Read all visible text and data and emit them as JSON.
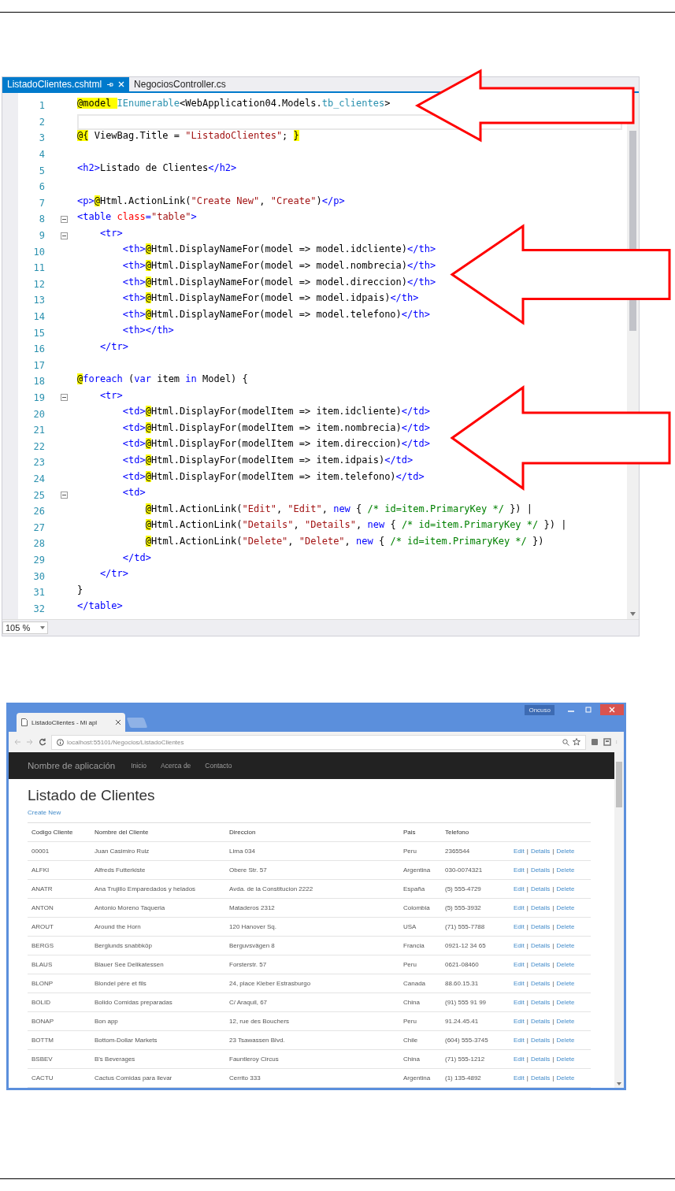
{
  "editor": {
    "tabs": [
      {
        "label": "ListadoClientes.cshtml",
        "selected": true
      },
      {
        "label": "NegociosController.cs",
        "selected": false
      }
    ],
    "lines": [
      {
        "number": "1",
        "segments": [
          {
            "kind": "razor",
            "text": "@model "
          },
          {
            "kind": "type",
            "text": "IEnumerable"
          },
          {
            "kind": "plain",
            "text": "<WebApplication04.Models."
          },
          {
            "kind": "type",
            "text": "tb_clientes"
          },
          {
            "kind": "plain",
            "text": ">"
          }
        ]
      },
      {
        "number": "2",
        "current": true
      },
      {
        "number": "3",
        "segments": [
          {
            "kind": "razor",
            "text": "@{"
          },
          {
            "kind": "plain",
            "text": " ViewBag.Title = "
          },
          {
            "kind": "string",
            "text": "\"ListadoClientes\""
          },
          {
            "kind": "plain",
            "text": "; "
          },
          {
            "kind": "razor",
            "text": "}"
          }
        ]
      },
      {
        "number": "4"
      },
      {
        "number": "5",
        "segments": [
          {
            "kind": "tag",
            "text": "<h2>"
          },
          {
            "kind": "plain",
            "text": "Listado de Clientes"
          },
          {
            "kind": "tag",
            "text": "</h2>"
          }
        ]
      },
      {
        "number": "6"
      },
      {
        "number": "7",
        "segments": [
          {
            "kind": "tag",
            "text": "<p>"
          },
          {
            "kind": "razor",
            "text": "@"
          },
          {
            "kind": "plain",
            "text": "Html.ActionLink("
          },
          {
            "kind": "string",
            "text": "\"Create New\""
          },
          {
            "kind": "plain",
            "text": ", "
          },
          {
            "kind": "string",
            "text": "\"Create\""
          },
          {
            "kind": "plain",
            "text": ")"
          },
          {
            "kind": "tag",
            "text": "</p>"
          }
        ]
      },
      {
        "number": "8",
        "fold": true,
        "segments": [
          {
            "kind": "tag",
            "text": "<table "
          },
          {
            "kind": "attr",
            "text": "class"
          },
          {
            "kind": "tag",
            "text": "="
          },
          {
            "kind": "string",
            "text": "\"table\""
          },
          {
            "kind": "tag",
            "text": ">"
          }
        ]
      },
      {
        "number": "9",
        "fold": true,
        "segments": [
          {
            "kind": "tag",
            "text": "    <tr>"
          }
        ]
      },
      {
        "number": "10",
        "segments": [
          {
            "kind": "tag",
            "text": "        <th>"
          },
          {
            "kind": "razor",
            "text": "@"
          },
          {
            "kind": "plain",
            "text": "Html.DisplayNameFor(model => model.idcliente)"
          },
          {
            "kind": "tag",
            "text": "</th>"
          }
        ]
      },
      {
        "number": "11",
        "segments": [
          {
            "kind": "tag",
            "text": "        <th>"
          },
          {
            "kind": "razor",
            "text": "@"
          },
          {
            "kind": "plain",
            "text": "Html.DisplayNameFor(model => model.nombrecia)"
          },
          {
            "kind": "tag",
            "text": "</th>"
          }
        ]
      },
      {
        "number": "12",
        "segments": [
          {
            "kind": "tag",
            "text": "        <th>"
          },
          {
            "kind": "razor",
            "text": "@"
          },
          {
            "kind": "plain",
            "text": "Html.DisplayNameFor(model => model.direccion)"
          },
          {
            "kind": "tag",
            "text": "</th>"
          }
        ]
      },
      {
        "number": "13",
        "segments": [
          {
            "kind": "tag",
            "text": "        <th>"
          },
          {
            "kind": "razor",
            "text": "@"
          },
          {
            "kind": "plain",
            "text": "Html.DisplayNameFor(model => model.idpais)"
          },
          {
            "kind": "tag",
            "text": "</th>"
          }
        ]
      },
      {
        "number": "14",
        "segments": [
          {
            "kind": "tag",
            "text": "        <th>"
          },
          {
            "kind": "razor",
            "text": "@"
          },
          {
            "kind": "plain",
            "text": "Html.DisplayNameFor(model => model.telefono)"
          },
          {
            "kind": "tag",
            "text": "</th>"
          }
        ]
      },
      {
        "number": "15",
        "segments": [
          {
            "kind": "tag",
            "text": "        <th></th>"
          }
        ]
      },
      {
        "number": "16",
        "segments": [
          {
            "kind": "tag",
            "text": "    </tr>"
          }
        ]
      },
      {
        "number": "17"
      },
      {
        "number": "18",
        "segments": [
          {
            "kind": "razor",
            "text": "@"
          },
          {
            "kind": "keyword",
            "text": "foreach"
          },
          {
            "kind": "plain",
            "text": " ("
          },
          {
            "kind": "keyword",
            "text": "var"
          },
          {
            "kind": "plain",
            "text": " item "
          },
          {
            "kind": "keyword",
            "text": "in"
          },
          {
            "kind": "plain",
            "text": " Model) {"
          }
        ]
      },
      {
        "number": "19",
        "fold": true,
        "segments": [
          {
            "kind": "tag",
            "text": "    <tr>"
          }
        ]
      },
      {
        "number": "20",
        "segments": [
          {
            "kind": "tag",
            "text": "        <td>"
          },
          {
            "kind": "razor",
            "text": "@"
          },
          {
            "kind": "plain",
            "text": "Html.DisplayFor(modelItem => item.idcliente)"
          },
          {
            "kind": "tag",
            "text": "</td>"
          }
        ]
      },
      {
        "number": "21",
        "segments": [
          {
            "kind": "tag",
            "text": "        <td>"
          },
          {
            "kind": "razor",
            "text": "@"
          },
          {
            "kind": "plain",
            "text": "Html.DisplayFor(modelItem => item.nombrecia)"
          },
          {
            "kind": "tag",
            "text": "</td>"
          }
        ]
      },
      {
        "number": "22",
        "segments": [
          {
            "kind": "tag",
            "text": "        <td>"
          },
          {
            "kind": "razor",
            "text": "@"
          },
          {
            "kind": "plain",
            "text": "Html.DisplayFor(modelItem => item.direccion)"
          },
          {
            "kind": "tag",
            "text": "</td>"
          }
        ]
      },
      {
        "number": "23",
        "segments": [
          {
            "kind": "tag",
            "text": "        <td>"
          },
          {
            "kind": "razor",
            "text": "@"
          },
          {
            "kind": "plain",
            "text": "Html.DisplayFor(modelItem => item.idpais)"
          },
          {
            "kind": "tag",
            "text": "</td>"
          }
        ]
      },
      {
        "number": "24",
        "segments": [
          {
            "kind": "tag",
            "text": "        <td>"
          },
          {
            "kind": "razor",
            "text": "@"
          },
          {
            "kind": "plain",
            "text": "Html.DisplayFor(modelItem => item.telefono)"
          },
          {
            "kind": "tag",
            "text": "</td>"
          }
        ]
      },
      {
        "number": "25",
        "fold": true,
        "segments": [
          {
            "kind": "tag",
            "text": "        <td>"
          }
        ]
      },
      {
        "number": "26",
        "segments": [
          {
            "kind": "razor",
            "text": "            @"
          },
          {
            "kind": "plain",
            "text": "Html.ActionLink("
          },
          {
            "kind": "string",
            "text": "\"Edit\""
          },
          {
            "kind": "plain",
            "text": ", "
          },
          {
            "kind": "string",
            "text": "\"Edit\""
          },
          {
            "kind": "plain",
            "text": ", "
          },
          {
            "kind": "keyword",
            "text": "new"
          },
          {
            "kind": "plain",
            "text": " { "
          },
          {
            "kind": "comment",
            "text": "/* id=item.PrimaryKey */"
          },
          {
            "kind": "plain",
            "text": " }) |"
          }
        ]
      },
      {
        "number": "27",
        "segments": [
          {
            "kind": "razor",
            "text": "            @"
          },
          {
            "kind": "plain",
            "text": "Html.ActionLink("
          },
          {
            "kind": "string",
            "text": "\"Details\""
          },
          {
            "kind": "plain",
            "text": ", "
          },
          {
            "kind": "string",
            "text": "\"Details\""
          },
          {
            "kind": "plain",
            "text": ", "
          },
          {
            "kind": "keyword",
            "text": "new"
          },
          {
            "kind": "plain",
            "text": " { "
          },
          {
            "kind": "comment",
            "text": "/* id=item.PrimaryKey */"
          },
          {
            "kind": "plain",
            "text": " }) |"
          }
        ]
      },
      {
        "number": "28",
        "segments": [
          {
            "kind": "razor",
            "text": "            @"
          },
          {
            "kind": "plain",
            "text": "Html.ActionLink("
          },
          {
            "kind": "string",
            "text": "\"Delete\""
          },
          {
            "kind": "plain",
            "text": ", "
          },
          {
            "kind": "string",
            "text": "\"Delete\""
          },
          {
            "kind": "plain",
            "text": ", "
          },
          {
            "kind": "keyword",
            "text": "new"
          },
          {
            "kind": "plain",
            "text": " { "
          },
          {
            "kind": "comment",
            "text": "/* id=item.PrimaryKey */"
          },
          {
            "kind": "plain",
            "text": " })"
          }
        ]
      },
      {
        "number": "29",
        "segments": [
          {
            "kind": "tag",
            "text": "        </td>"
          }
        ]
      },
      {
        "number": "30",
        "segments": [
          {
            "kind": "tag",
            "text": "    </tr>"
          }
        ]
      },
      {
        "number": "31",
        "segments": [
          {
            "kind": "plain",
            "text": "}"
          }
        ]
      },
      {
        "number": "32",
        "segments": [
          {
            "kind": "tag",
            "text": "</table>"
          }
        ]
      }
    ],
    "zoom": "105 %"
  },
  "browser": {
    "tab_title": "ListadoClientes - Mi apl",
    "profile": "Oncuso",
    "url": "localhost:55101/Negocios/ListadoClientes",
    "nav": {
      "brand": "Nombre de aplicación",
      "links": [
        "Inicio",
        "Acerca de",
        "Contacto"
      ]
    },
    "heading": "Listado de Clientes",
    "create_link": "Create New",
    "table": {
      "columns": [
        "Codigo Cliente",
        "Nombre del Cliente",
        "Direccion",
        "Pais",
        "Telefono"
      ],
      "separator": "|",
      "rows": [
        {
          "cells": [
            "00001",
            "Juan Casimiro Ruiz",
            "Lima 034",
            "Peru",
            "2365544"
          ],
          "actions": [
            "Edit",
            "Details",
            "Delete"
          ]
        },
        {
          "cells": [
            "ALFKI",
            "Alfreds Futterkiste",
            "Obere Str. 57",
            "Argentina",
            "030-0074321"
          ],
          "actions": [
            "Edit",
            "Details",
            "Delete"
          ]
        },
        {
          "cells": [
            "ANATR",
            "Ana Trujillo Emparedados y helados",
            "Avda. de la Constitucion 2222",
            "España",
            "(5) 555-4729"
          ],
          "actions": [
            "Edit",
            "Details",
            "Delete"
          ]
        },
        {
          "cells": [
            "ANTON",
            "Antonio Moreno Taqueria",
            "Mataderos 2312",
            "Colombia",
            "(5) 555-3932"
          ],
          "actions": [
            "Edit",
            "Details",
            "Delete"
          ]
        },
        {
          "cells": [
            "AROUT",
            "Around the Horn",
            "120 Hanover Sq.",
            "USA",
            "(71) 555-7788"
          ],
          "actions": [
            "Edit",
            "Details",
            "Delete"
          ]
        },
        {
          "cells": [
            "BERGS",
            "Berglunds snabbköp",
            "Berguvsvägen 8",
            "Francia",
            "0921-12 34 65"
          ],
          "actions": [
            "Edit",
            "Details",
            "Delete"
          ]
        },
        {
          "cells": [
            "BLAUS",
            "Blauer See Delikatessen",
            "Forsterstr. 57",
            "Peru",
            "0621-08460"
          ],
          "actions": [
            "Edit",
            "Details",
            "Delete"
          ]
        },
        {
          "cells": [
            "BLONP",
            "Blondel père et fils",
            "24, place Kleber Estrasburgo",
            "Canada",
            "88.60.15.31"
          ],
          "actions": [
            "Edit",
            "Details",
            "Delete"
          ]
        },
        {
          "cells": [
            "BOLID",
            "Bolido Comidas preparadas",
            "C/ Araquil, 67",
            "China",
            "(91) 555 91 99"
          ],
          "actions": [
            "Edit",
            "Details",
            "Delete"
          ]
        },
        {
          "cells": [
            "BONAP",
            "Bon app",
            "12, rue des Bouchers",
            "Peru",
            "91.24.45.41"
          ],
          "actions": [
            "Edit",
            "Details",
            "Delete"
          ]
        },
        {
          "cells": [
            "BOTTM",
            "Bottom-Dollar Markets",
            "23 Tsawassen Blvd.",
            "Chile",
            "(604) 555-3745"
          ],
          "actions": [
            "Edit",
            "Details",
            "Delete"
          ]
        },
        {
          "cells": [
            "BSBEV",
            "B's Beverages",
            "Fauntleroy Circus",
            "China",
            "(71) 555-1212"
          ],
          "actions": [
            "Edit",
            "Details",
            "Delete"
          ]
        },
        {
          "cells": [
            "CACTU",
            "Cactus Comidas para llevar",
            "Cerrito 333",
            "Argentina",
            "(1) 135-4892"
          ],
          "actions": [
            "Edit",
            "Details",
            "Delete"
          ]
        }
      ]
    }
  }
}
